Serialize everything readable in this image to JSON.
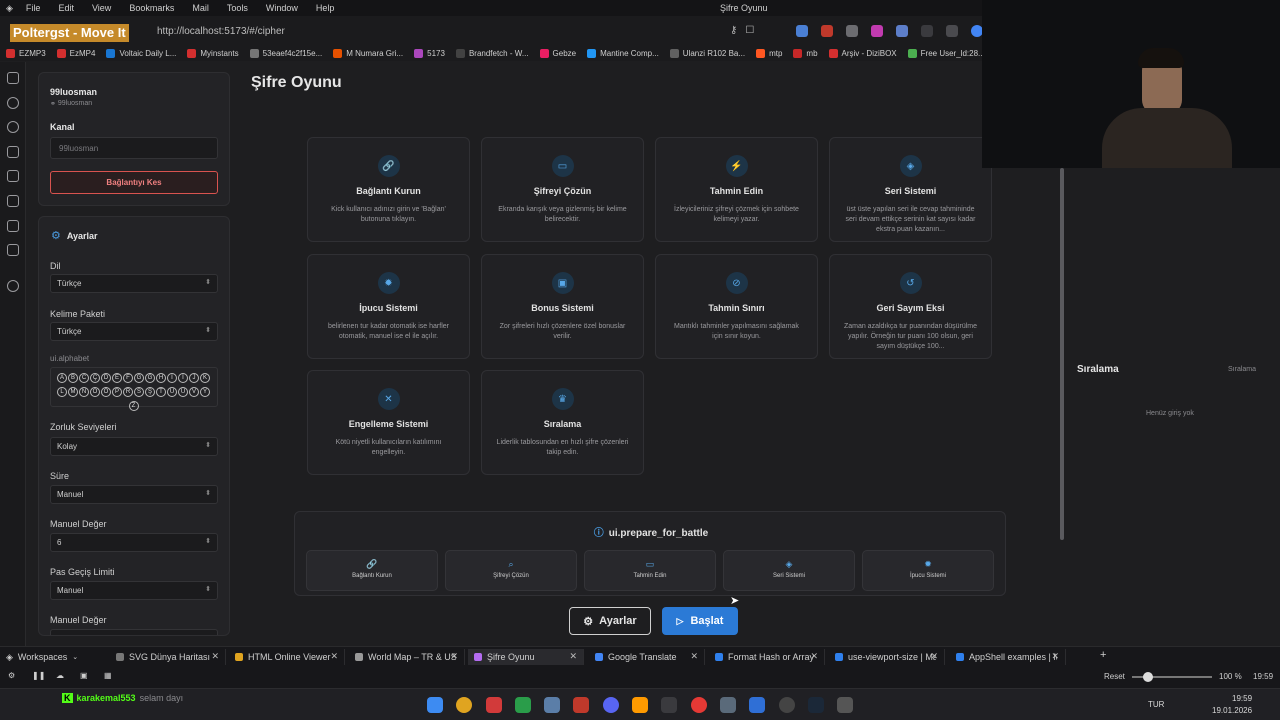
{
  "menubar": {
    "items": [
      "File",
      "Edit",
      "View",
      "Bookmarks",
      "Mail",
      "Tools",
      "Window",
      "Help"
    ],
    "window_title": "Şifre Oyunu"
  },
  "browser": {
    "overlay_title": "Poltergst - Move It",
    "url": "http://localhost:5173/#/cipher",
    "bookmarks": [
      "EZMP3",
      "EzMP4",
      "Voltaic Daily L...",
      "Myinstants",
      "53eaef4c2f15e...",
      "M Numara Gri...",
      "5173",
      "Brandfetch - W...",
      "Gebze",
      "Mantine Comp...",
      "Ulanzi R102 Ba...",
      "mtp",
      "mb",
      "Arşiv - DiziBOX",
      "Free User_ld:28..."
    ]
  },
  "sidebar": {
    "username": "99luosman",
    "user_sub": "99luosman",
    "channel_label": "Kanal",
    "channel_placeholder": "99luosman",
    "disconnect_label": "Bağlantıyı Kes",
    "settings_title": "Ayarlar",
    "language_label": "Dil",
    "language_value": "Türkçe",
    "wordpack_label": "Kelime Paketi",
    "wordpack_value": "Türkçe",
    "alphabet_label": "ui.alphabet",
    "alphabet": [
      "A",
      "B",
      "C",
      "Ç",
      "D",
      "E",
      "F",
      "G",
      "Ğ",
      "H",
      "I",
      "İ",
      "J",
      "K",
      "L",
      "M",
      "N",
      "O",
      "Ö",
      "P",
      "R",
      "S",
      "Ş",
      "T",
      "U",
      "Ü",
      "V",
      "Y",
      "Z"
    ],
    "difficulty_label": "Zorluk Seviyeleri",
    "difficulty_value": "Kolay",
    "time_label": "Süre",
    "time_value": "Manuel",
    "manual_value_label": "Manuel Değer",
    "manual_value": "6",
    "pass_limit_label": "Pas Geçiş Limiti",
    "pass_limit_value": "Manuel",
    "manual_value_label2": "Manuel Değer"
  },
  "main": {
    "title": "Şifre Oyunu",
    "cards": [
      {
        "icon": "link-icon",
        "glyph": "🔗",
        "title": "Bağlantı Kurun",
        "desc": "Kick kullanıcı adınızı girin ve 'Bağlan' butonuna tıklayın."
      },
      {
        "icon": "message-icon",
        "glyph": "▭",
        "title": "Şifreyi Çözün",
        "desc": "Ekranda karışık veya gizlenmiş bir kelime belirecektir."
      },
      {
        "icon": "bolt-icon",
        "glyph": "⚡",
        "title": "Tahmin Edin",
        "desc": "İzleyicileriniz şifreyi çözmek için sohbete kelimeyi yazar."
      },
      {
        "icon": "flame-icon",
        "glyph": "◈",
        "title": "Seri Sistemi",
        "desc": "üst üste yapılan seri ile cevap tahmininde seri devam ettikçe serinin kat sayısı kadar ekstra puan kazanın..."
      },
      {
        "icon": "bulb-icon",
        "glyph": "✹",
        "title": "İpucu Sistemi",
        "desc": "belirlenen tur kadar otomatik ise harfler otomatik, manuel ise el ile açılır."
      },
      {
        "icon": "gift-icon",
        "glyph": "▣",
        "title": "Bonus Sistemi",
        "desc": "Zor şifreleri hızlı çözenlere özel bonuslar verilir."
      },
      {
        "icon": "ban-icon",
        "glyph": "⊘",
        "title": "Tahmin Sınırı",
        "desc": "Mantıklı tahminler yapılmasını sağlamak için sınır koyun."
      },
      {
        "icon": "history-icon",
        "glyph": "↺",
        "title": "Geri Sayım Eksi",
        "desc": "Zaman azaldıkça tur puanından düşürülme yapılır. Örneğin tur puanı 100 olsun, geri sayım düştükçe 100..."
      },
      {
        "icon": "block-user-icon",
        "glyph": "✕",
        "title": "Engelleme Sistemi",
        "desc": "Kötü niyetli kullanıcıların katılımını engelleyin."
      },
      {
        "icon": "trophy-icon",
        "glyph": "♛",
        "title": "Sıralama",
        "desc": "Liderlik tablosundan en hızlı şifre çözenleri takip edin."
      }
    ],
    "battle_title": "ui.prepare_for_battle",
    "battle_items": [
      {
        "glyph": "🔗",
        "label": "Bağlantı Kurun"
      },
      {
        "glyph": "⌕",
        "label": "Şifreyi Çözün"
      },
      {
        "glyph": "▭",
        "label": "Tahmin Edin"
      },
      {
        "glyph": "◈",
        "label": "Seri Sistemi"
      },
      {
        "glyph": "✹",
        "label": "İpucu Sistemi"
      }
    ],
    "settings_button": "Ayarlar",
    "start_button": "Başlat"
  },
  "ranking": {
    "title": "Sıralama",
    "small": "Sıralama",
    "empty": "Henüz giriş yok"
  },
  "tabs": {
    "workspaces": "Workspaces",
    "items": [
      "SVG Dünya Haritası",
      "HTML Online Viewer",
      "World Map – TR & US",
      "Şifre Oyunu",
      "Google Translate",
      "Format Hash or Array",
      "use-viewport-size | Ma",
      "AppShell examples | M"
    ]
  },
  "status": {
    "reset": "Reset",
    "zoom": "100 %",
    "time": "19:59"
  },
  "taskbar": {
    "chat_user": "karakemal553",
    "chat_msg": "selam dayı",
    "lang": "TUR",
    "clock": "19:59",
    "date": "19.01.2026"
  }
}
